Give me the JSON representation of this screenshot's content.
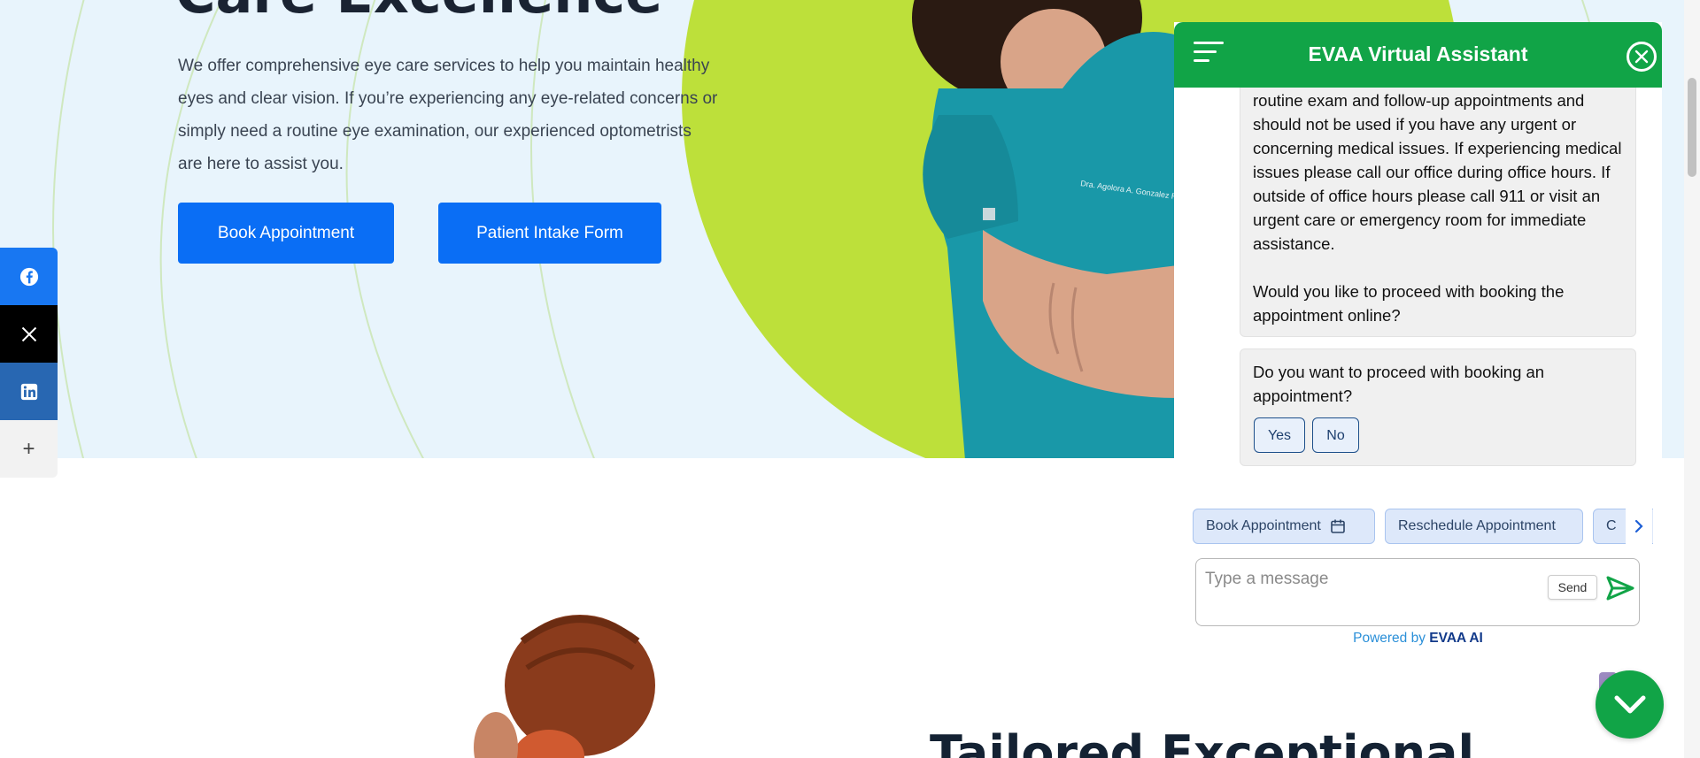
{
  "hero": {
    "heading": "Care Excellence",
    "description": "We offer comprehensive eye care services to help you maintain healthy eyes and clear vision. If you’re experiencing any eye-related concerns or simply need a routine eye examination, our experienced optometrists are here to assist you.",
    "book_button": "Book Appointment",
    "intake_button": "Patient Intake Form",
    "scrub_text": "Dra. Agolora A. Gonzalez Rodriguez"
  },
  "social": {
    "facebook": "f",
    "x": "X",
    "linkedin": "in",
    "more": "+"
  },
  "lower": {
    "heading": "Tailored Exceptional"
  },
  "chat": {
    "title": "EVAA Virtual Assistant",
    "message1_p1": "routine exam and follow-up appointments and should not be used if you have any urgent or concerning medical issues. If experiencing medical issues please call our office during office hours. If outside of office hours please call 911 or visit an urgent care or emergency room for immediate assistance.",
    "message1_p2": "Would you like to proceed with booking the appointment online?",
    "message2": "Do you want to proceed with booking an appointment?",
    "yes_label": "Yes",
    "no_label": "No",
    "chips": [
      "Book Appointment",
      "Reschedule Appointment",
      "C"
    ],
    "input_placeholder": "Type a message",
    "send_label": "Send",
    "powered_prefix": "Powered by",
    "powered_brand": "EVAA AI"
  },
  "colors": {
    "chat_green": "#11a447",
    "hero_blue_button": "#0a6ef5",
    "lime": "#bde03a",
    "hero_bg": "#e8f4fc"
  }
}
